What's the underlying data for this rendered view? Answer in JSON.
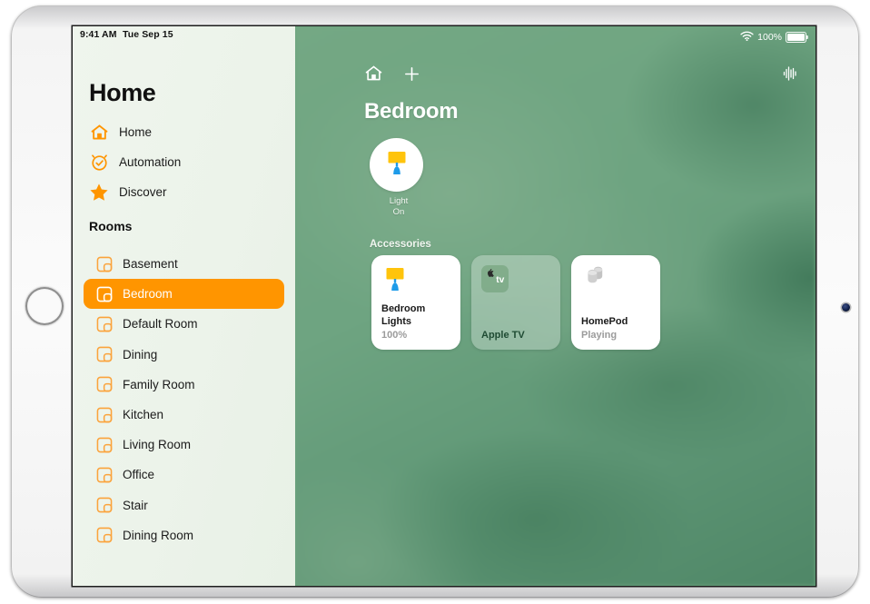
{
  "status_bar": {
    "time": "9:41 AM",
    "date": "Tue Sep 15",
    "wifi_icon": "wifi-icon",
    "battery_percent": "100%",
    "battery_icon": "battery-full-icon"
  },
  "sidebar": {
    "title": "Home",
    "nav": [
      {
        "label": "Home",
        "icon": "house-icon"
      },
      {
        "label": "Automation",
        "icon": "automation-clock-icon"
      },
      {
        "label": "Discover",
        "icon": "star-icon"
      }
    ],
    "rooms_header": "Rooms",
    "rooms": [
      {
        "label": "Basement",
        "icon": "room-icon",
        "selected": false
      },
      {
        "label": "Bedroom",
        "icon": "room-icon",
        "selected": true
      },
      {
        "label": "Default Room",
        "icon": "room-icon",
        "selected": false
      },
      {
        "label": "Dining",
        "icon": "room-icon",
        "selected": false
      },
      {
        "label": "Family Room",
        "icon": "room-icon",
        "selected": false
      },
      {
        "label": "Kitchen",
        "icon": "room-icon",
        "selected": false
      },
      {
        "label": "Living Room",
        "icon": "room-icon",
        "selected": false
      },
      {
        "label": "Office",
        "icon": "room-icon",
        "selected": false
      },
      {
        "label": "Stair",
        "icon": "room-icon",
        "selected": false
      },
      {
        "label": "Dining Room",
        "icon": "room-icon",
        "selected": false
      }
    ]
  },
  "main": {
    "home_icon": "house-icon",
    "add_icon": "plus-icon",
    "audio_icon": "audio-waveform-icon",
    "title": "Bedroom",
    "scene": {
      "icon": "lamp-icon",
      "name": "Light",
      "state": "On"
    },
    "accessories_header": "Accessories",
    "accessories": [
      {
        "name": "Bedroom Lights",
        "status": "100%",
        "icon": "lamp-icon",
        "style": "white"
      },
      {
        "name": "Apple TV",
        "status": "",
        "icon": "apple-tv-icon",
        "style": "glass"
      },
      {
        "name": "HomePod",
        "status": "Playing",
        "icon": "homepod-pair-icon",
        "style": "white"
      }
    ]
  },
  "colors": {
    "accent_orange": "#FF9500",
    "sidebar_bg": "#eef4ec",
    "wallpaper_green": "#6fa57f",
    "lamp_shade": "#FFC40C",
    "lamp_base": "#1E9BE9"
  }
}
